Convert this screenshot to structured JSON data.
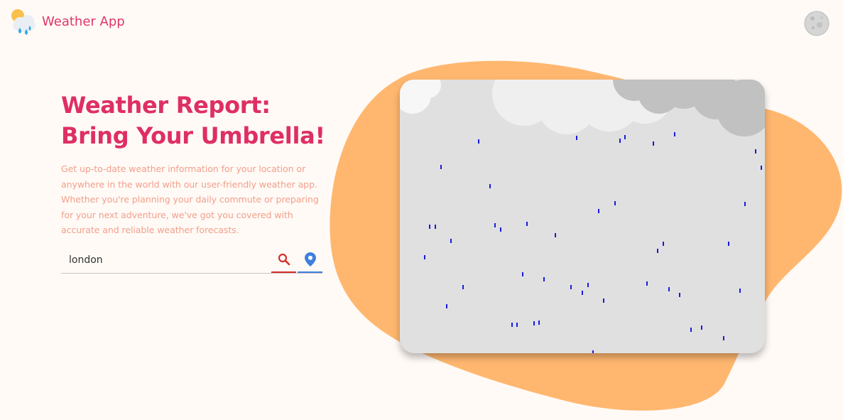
{
  "header": {
    "app_title": "Weather App",
    "logo_icon": "cloud-rain-sun-icon",
    "theme_toggle_icon": "moon-icon"
  },
  "hero": {
    "title": "Weather Report: Bring Your Umbrella!",
    "description": "Get up-to-date weather information for your location or anywhere in the world with our user-friendly weather app. Whether you're planning your daily commute or preparing for your next adventure, we've got you covered with accurate and reliable weather forecasts."
  },
  "search": {
    "value": "london",
    "search_icon": "search-icon",
    "location_icon": "location-pin-icon"
  },
  "illustration": {
    "scene": "rain",
    "card_color": "#e0e0e0",
    "blob_color": "#ffb76f",
    "raindrop_color": "#1a1adb"
  },
  "colors": {
    "accent": "#de2f63",
    "description": "#f2a08c",
    "search_red": "#d32f2f",
    "location_blue": "#3f7fe0"
  }
}
